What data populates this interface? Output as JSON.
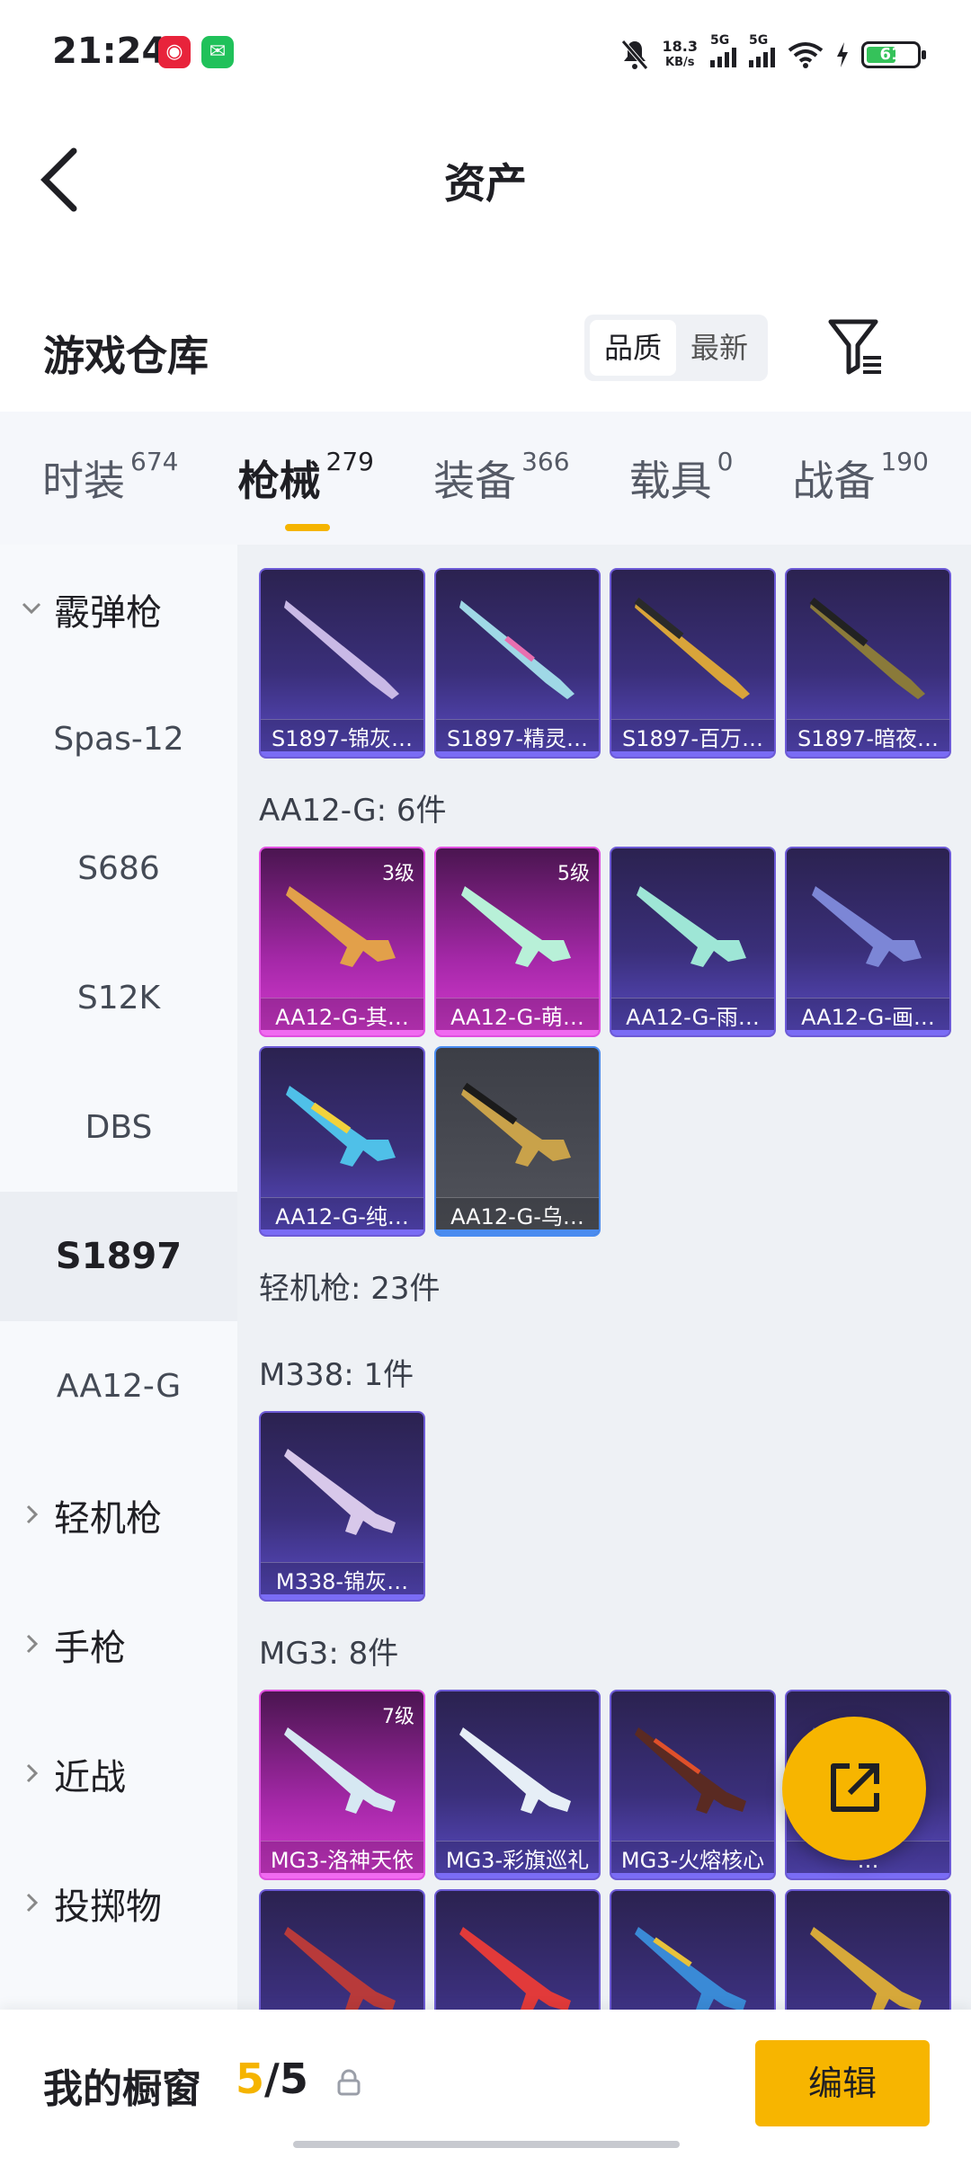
{
  "status_bar": {
    "time": "21:24",
    "apps": [
      "netease-music-icon",
      "wechat-icon"
    ],
    "speed_value": "18.3",
    "speed_unit": "KB/s",
    "signal1": "5G",
    "signal2": "5G",
    "battery": "61"
  },
  "header": {
    "title": "资产"
  },
  "section": {
    "title": "游戏仓库",
    "sort_options": [
      "品质",
      "最新"
    ],
    "sort_selected": "品质"
  },
  "tabs": [
    {
      "name": "时装",
      "count": "674"
    },
    {
      "name": "枪械",
      "count": "279",
      "active": true
    },
    {
      "name": "装备",
      "count": "366"
    },
    {
      "name": "载具",
      "count": "0"
    },
    {
      "name": "战备",
      "count": "190"
    }
  ],
  "sidebar": {
    "group_open": "霰弹枪",
    "items": [
      "Spas-12",
      "S686",
      "S12K",
      "DBS",
      "S1897",
      "AA12-G"
    ],
    "active": "S1897",
    "groups_closed": [
      "轻机枪",
      "手枪",
      "近战",
      "投掷物"
    ]
  },
  "content": {
    "s1897_cards": [
      {
        "name": "S1897-锦灰…",
        "rarity": "purple"
      },
      {
        "name": "S1897-精灵…",
        "rarity": "purple"
      },
      {
        "name": "S1897-百万…",
        "rarity": "purple"
      },
      {
        "name": "S1897-暗夜…",
        "rarity": "purple"
      }
    ],
    "aa12_label": "AA12-G: 6件",
    "aa12_cards": [
      {
        "name": "AA12-G-其…",
        "rarity": "pink",
        "level": "3级"
      },
      {
        "name": "AA12-G-萌…",
        "rarity": "pink",
        "level": "5级"
      },
      {
        "name": "AA12-G-雨…",
        "rarity": "purple"
      },
      {
        "name": "AA12-G-画…",
        "rarity": "purple"
      },
      {
        "name": "AA12-G-纯…",
        "rarity": "purple"
      },
      {
        "name": "AA12-G-乌…",
        "rarity": "gray"
      }
    ],
    "lmg_label": "轻机枪: 23件",
    "m338_label": "M338: 1件",
    "m338_cards": [
      {
        "name": "M338-锦灰…",
        "rarity": "purple"
      }
    ],
    "mg3_label": "MG3: 8件",
    "mg3_cards": [
      {
        "name": "MG3-洛神天依",
        "rarity": "pink",
        "level": "7级"
      },
      {
        "name": "MG3-彩旗巡礼",
        "rarity": "purple"
      },
      {
        "name": "MG3-火熔核心",
        "rarity": "purple"
      },
      {
        "name": "…",
        "rarity": "purple"
      }
    ]
  },
  "bottom_bar": {
    "title": "我的橱窗",
    "count_current": "5",
    "count_total": "/5",
    "edit_label": "编辑"
  }
}
